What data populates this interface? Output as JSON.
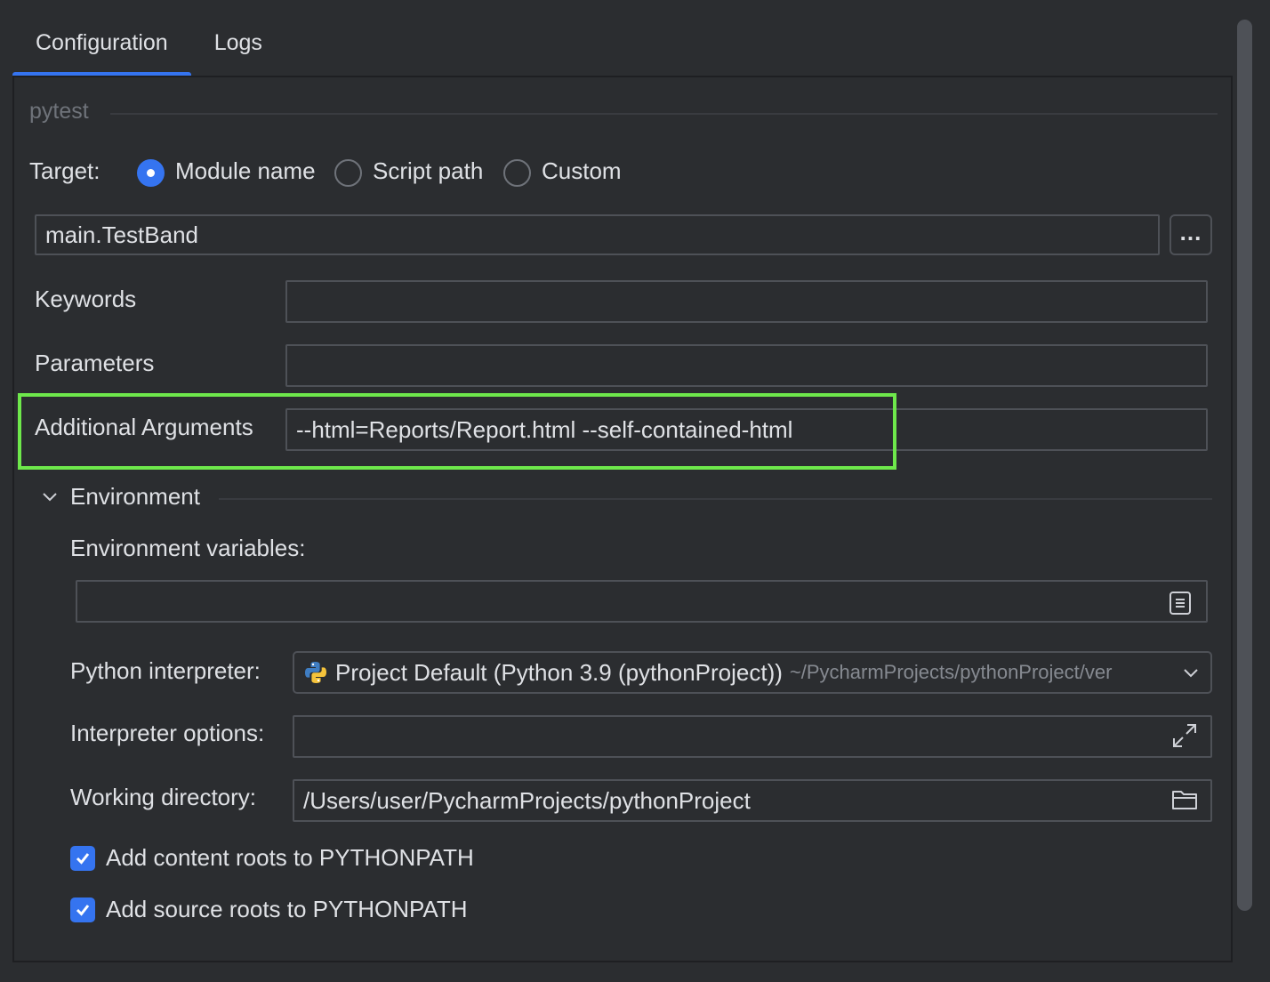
{
  "tabs": [
    {
      "label": "Configuration",
      "active": true
    },
    {
      "label": "Logs",
      "active": false
    }
  ],
  "section": {
    "title": "pytest"
  },
  "target": {
    "label": "Target:",
    "options": [
      {
        "label": "Module name",
        "selected": true
      },
      {
        "label": "Script path",
        "selected": false
      },
      {
        "label": "Custom",
        "selected": false
      }
    ],
    "value": "main.TestBand",
    "browse_label": "..."
  },
  "keywords": {
    "label": "Keywords",
    "value": ""
  },
  "parameters": {
    "label": "Parameters",
    "value": ""
  },
  "additional_arguments": {
    "label": "Additional Arguments",
    "value": "--html=Reports/Report.html  --self-contained-html"
  },
  "environment": {
    "title": "Environment",
    "env_vars": {
      "label": "Environment variables:",
      "value": ""
    },
    "python_interpreter": {
      "label": "Python interpreter:",
      "value": "Project Default (Python 3.9 (pythonProject))",
      "path_hint": "~/PycharmProjects/pythonProject/ver"
    },
    "interpreter_options": {
      "label": "Interpreter options:",
      "value": ""
    },
    "working_directory": {
      "label": "Working directory:",
      "value": "/Users/user/PycharmProjects/pythonProject"
    },
    "add_content_roots": {
      "label": "Add content roots to PYTHONPATH",
      "checked": true
    },
    "add_source_roots": {
      "label": "Add source roots to PYTHONPATH",
      "checked": true
    }
  },
  "colors": {
    "background": "#2b2d30",
    "accent": "#3574f0",
    "highlight": "#6ee84b",
    "border": "#4e5157"
  }
}
